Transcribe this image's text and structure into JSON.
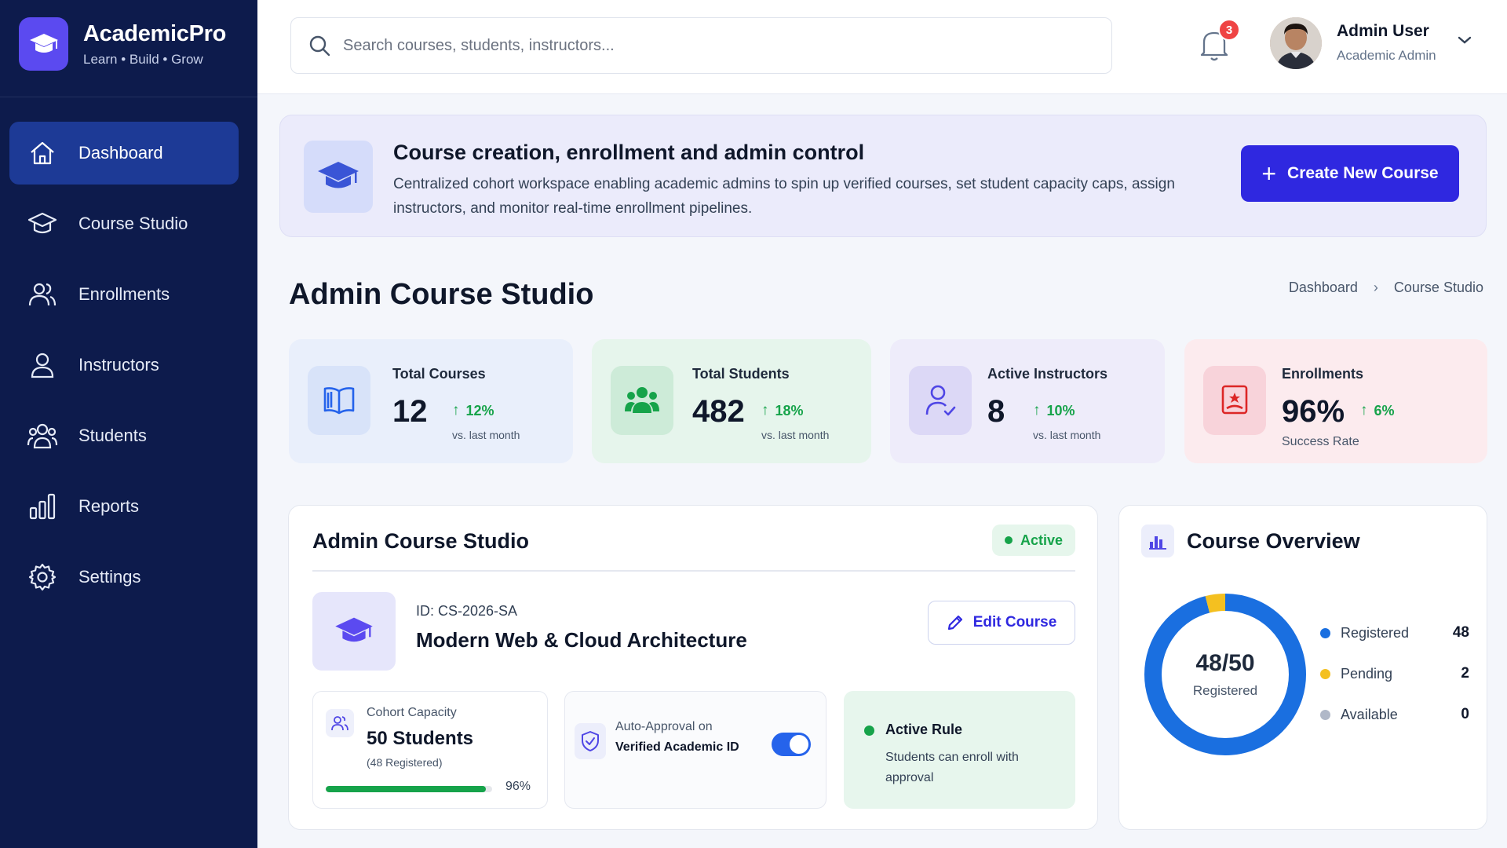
{
  "brand": {
    "name": "AcademicPro",
    "tagline": "Learn • Build • Grow",
    "accent": "#5b4af0"
  },
  "sidebar": {
    "bg": "#0d1b4c",
    "items": [
      {
        "label": "Dashboard",
        "icon": "home-icon",
        "active": true
      },
      {
        "label": "Course Studio",
        "icon": "graduation-cap-icon"
      },
      {
        "label": "Enrollments",
        "icon": "users-icon"
      },
      {
        "label": "Instructors",
        "icon": "user-icon"
      },
      {
        "label": "Students",
        "icon": "group-icon"
      },
      {
        "label": "Reports",
        "icon": "bar-chart-icon"
      },
      {
        "label": "Settings",
        "icon": "gear-icon"
      }
    ]
  },
  "topbar": {
    "search_placeholder": "Search courses, students, instructors...",
    "notifications": "3",
    "user_name": "Admin User",
    "user_role": "Academic Admin"
  },
  "banner": {
    "title": "Course creation, enrollment and admin control",
    "description": "Centralized cohort workspace enabling academic admins to spin up verified courses, set student capacity caps, assign instructors, and monitor real-time enrollment pipelines.",
    "button_label": "Create New Course",
    "button_color": "#2f28e0"
  },
  "page": {
    "title": "Admin Course Studio"
  },
  "breadcrumb": {
    "root": "Dashboard",
    "current": "Course Studio"
  },
  "stats": [
    {
      "label": "Total Courses",
      "value": "12",
      "trend": "12%",
      "sub": "vs. last month",
      "bg": "#e9effb",
      "icon_bg": "#d8e3f9",
      "icon": "book-icon"
    },
    {
      "label": "Total Students",
      "value": "482",
      "trend": "18%",
      "sub": "vs. last month",
      "bg": "#e6f5ec",
      "icon_bg": "#cdebd8",
      "icon": "students-icon"
    },
    {
      "label": "Active Instructors",
      "value": "8",
      "trend": "10%",
      "sub": "vs. last month",
      "bg": "#eeecfa",
      "icon_bg": "#dcd8f6",
      "icon": "instructor-icon"
    },
    {
      "label": "Enrollments",
      "value": "96%",
      "trend": "6%",
      "sub": "Success Rate",
      "bg": "#fcebee",
      "icon_bg": "#f8d3da",
      "icon": "certificate-icon"
    }
  ],
  "course_panel": {
    "title": "Admin Course Studio",
    "status": "Active",
    "course_id": "ID: CS-2026-SA",
    "course_name": "Modern Web & Cloud Architecture",
    "edit_label": "Edit Course",
    "capacity": {
      "label": "Cohort Capacity",
      "value": "50 Students",
      "sub": "(48 Registered)",
      "percent_text": "96%",
      "percent": 96
    },
    "auto_approval": {
      "label": "Auto-Approval on",
      "label_bold": "Verified Academic ID",
      "enabled": true
    },
    "rule": {
      "title": "Active Rule",
      "description": "Students can enroll with approval"
    }
  },
  "overview": {
    "title": "Course Overview",
    "center_value": "48/50",
    "center_label": "Registered",
    "legend": [
      {
        "label": "Registered",
        "value": "48",
        "color": "#1a6fe0"
      },
      {
        "label": "Pending",
        "value": "2",
        "color": "#f4c020"
      },
      {
        "label": "Available",
        "value": "0",
        "color": "#b0b8c8"
      }
    ]
  }
}
